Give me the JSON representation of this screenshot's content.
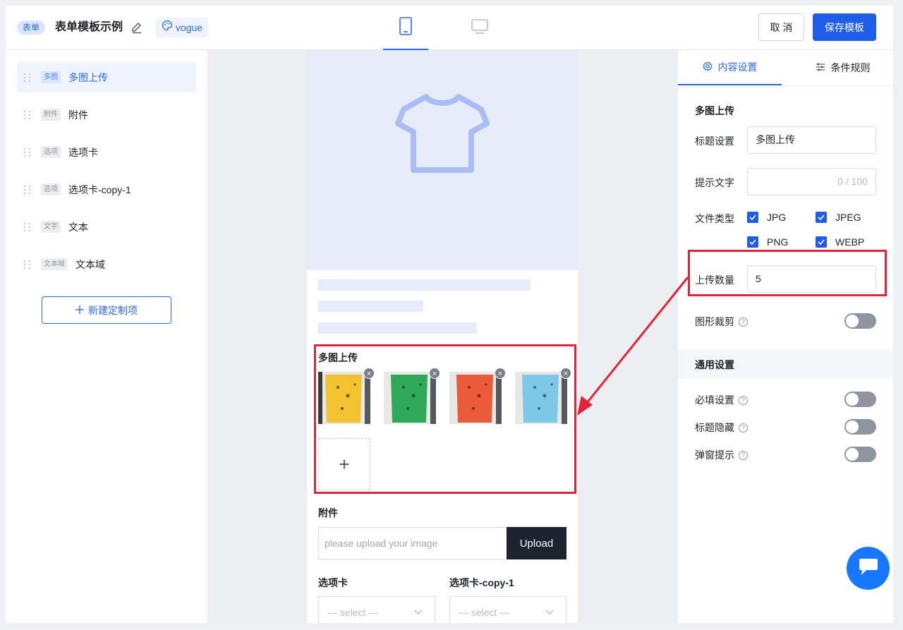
{
  "header": {
    "tag": "表单",
    "title": "表单模板示例",
    "theme": "vogue",
    "cancel_label": "取 消",
    "save_label": "保存模板"
  },
  "sidebar": {
    "items": [
      {
        "tag": "多图",
        "label": "多图上传",
        "active": true
      },
      {
        "tag": "附件",
        "label": "附件"
      },
      {
        "tag": "选项",
        "label": "选项卡"
      },
      {
        "tag": "选项",
        "label": "选项卡-copy-1"
      },
      {
        "tag": "文字",
        "label": "文本"
      },
      {
        "tag": "文本域",
        "label": "文本域"
      }
    ],
    "new_button": "新建定制项"
  },
  "preview": {
    "multi_upload_title": "多图上传",
    "images": [
      {
        "color": "#f2c230",
        "remove": "×"
      },
      {
        "color": "#2fa85a",
        "remove": "×"
      },
      {
        "color": "#ea5a3b",
        "remove": "×"
      },
      {
        "color": "#7cc8e6",
        "remove": "×"
      }
    ],
    "add_symbol": "+",
    "attachment_title": "附件",
    "upload_placeholder": "please upload your image",
    "upload_button": "Upload",
    "tab1_title": "选项卡",
    "tab2_title": "选项卡-copy-1",
    "select_placeholder": "--- select ---"
  },
  "settings": {
    "tabs": [
      "内容设置",
      "条件规则"
    ],
    "section_title": "多图上传",
    "title_label": "标题设置",
    "title_value": "多图上传",
    "hint_label": "提示文字",
    "hint_counter": "0 / 100",
    "file_type_label": "文件类型",
    "file_types": [
      {
        "label": "JPG",
        "checked": true
      },
      {
        "label": "JPEG",
        "checked": true
      },
      {
        "label": "PNG",
        "checked": true
      },
      {
        "label": "WEBP",
        "checked": true
      }
    ],
    "count_label": "上传数量",
    "count_value": "5",
    "crop_label": "图形裁剪",
    "crop_on": false,
    "general_title": "通用设置",
    "required_label": "必填设置",
    "required_on": false,
    "hide_title_label": "标题隐藏",
    "hide_title_on": false,
    "popup_label": "弹窗提示",
    "popup_on": false
  },
  "colors": {
    "accent": "#1f5de8",
    "highlight": "#e0253a"
  }
}
